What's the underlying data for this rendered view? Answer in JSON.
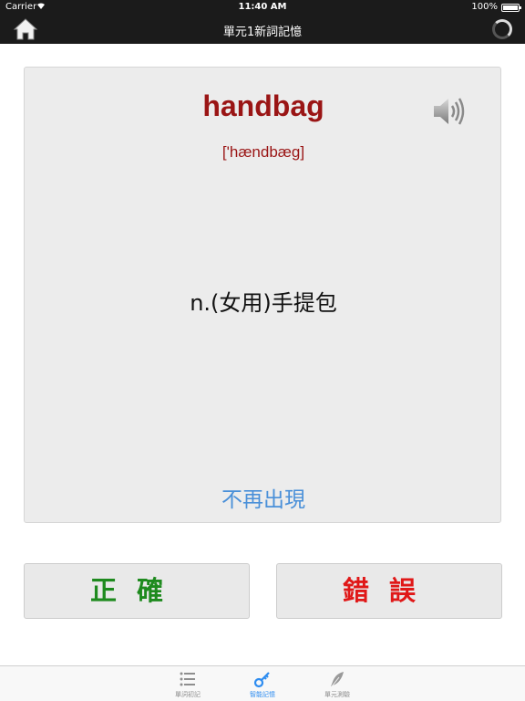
{
  "status_bar": {
    "carrier": "Carrier",
    "time": "11:40 AM",
    "battery": "100%"
  },
  "nav": {
    "title": "單元1新詞記憶"
  },
  "card": {
    "word": "handbag",
    "phonetic": "['hændbæg]",
    "meaning": "n.(女用)手提包",
    "hide_label": "不再出現"
  },
  "actions": {
    "correct_label": "正確",
    "wrong_label": "錯誤"
  },
  "tabs": [
    {
      "label": "單詞初記",
      "icon": "list-icon",
      "active": false
    },
    {
      "label": "智能記憶",
      "icon": "key-icon",
      "active": true
    },
    {
      "label": "單元測驗",
      "icon": "feather-icon",
      "active": false
    }
  ],
  "colors": {
    "word": "#9a1515",
    "correct": "#1e8a1e",
    "wrong": "#e01818",
    "link": "#4a90d9",
    "active_tab": "#2d8cf0"
  }
}
